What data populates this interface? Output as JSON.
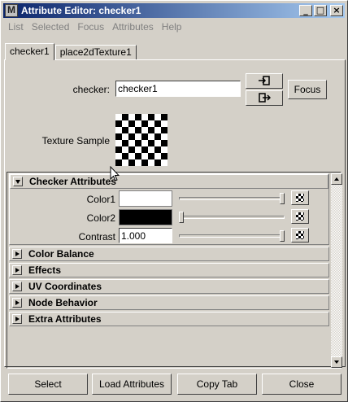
{
  "window": {
    "title": "Attribute Editor: checker1"
  },
  "title_buttons": {
    "minimize": "_",
    "maximize": "□",
    "close": "×"
  },
  "menu": [
    "List",
    "Selected",
    "Focus",
    "Attributes",
    "Help"
  ],
  "tabs": [
    {
      "label": "checker1",
      "active": true
    },
    {
      "label": "place2dTexture1",
      "active": false
    }
  ],
  "node": {
    "label": "checker:",
    "name": "checker1",
    "focus_label": "Focus",
    "texture_sample_label": "Texture Sample"
  },
  "sections": {
    "checker_attributes": {
      "label": "Checker Attributes",
      "expanded": true,
      "color1": {
        "label": "Color1",
        "color": "#ffffff",
        "slider_value": 1.0
      },
      "color2": {
        "label": "Color2",
        "color": "#000000",
        "slider_value": 0.0
      },
      "contrast": {
        "label": "Contrast",
        "value": "1.000",
        "slider_value": 1.0
      }
    },
    "collapsed": [
      {
        "label": "Color Balance"
      },
      {
        "label": "Effects"
      },
      {
        "label": "UV Coordinates"
      },
      {
        "label": "Node Behavior"
      },
      {
        "label": "Extra Attributes"
      }
    ]
  },
  "buttons": {
    "select": "Select",
    "load_attributes": "Load Attributes",
    "copy_tab": "Copy Tab",
    "close": "Close"
  },
  "icons": {
    "app": "maya-icon",
    "input_connection": "input-connection-icon",
    "output_connection": "output-connection-icon",
    "map": "checker-map-icon"
  },
  "colors": {
    "title_start": "#0a246a",
    "title_end": "#a6caf0",
    "face": "#d4d0c8"
  }
}
